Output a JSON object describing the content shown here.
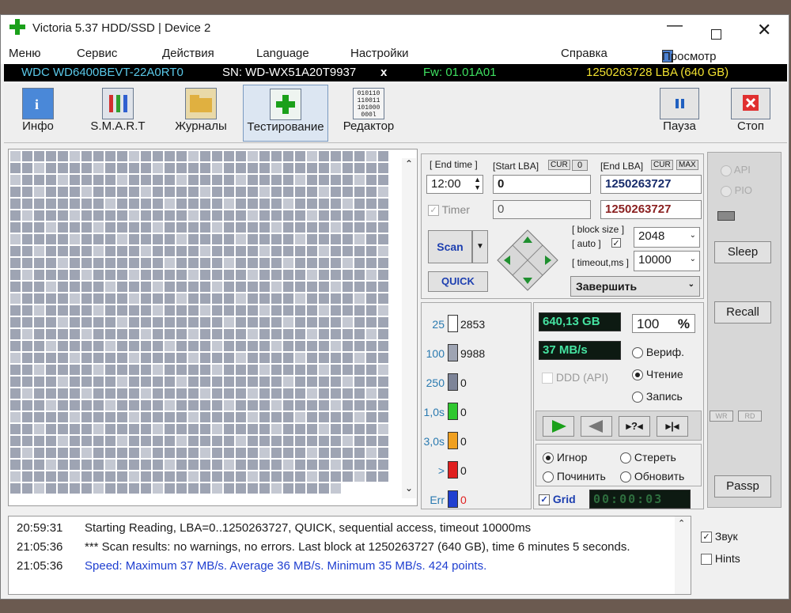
{
  "window": {
    "title": "Victoria 5.37 HDD/SSD | Device 2"
  },
  "menu": [
    "Меню",
    "Сервис",
    "Действия",
    "Language",
    "Настройки",
    "Справка"
  ],
  "menu_buffer": "Просмотр буфера",
  "device": {
    "model": "WDC WD6400BEVT-22A0RT0",
    "serial": "SN: WD-WX51A20T9937",
    "close": "x",
    "firmware": "Fw: 01.01A01",
    "capacity": "1250263728 LBA (640 GB)"
  },
  "toolbar": {
    "info": "Инфо",
    "smart": "S.M.A.R.T",
    "logs": "Журналы",
    "testing": "Тестирование",
    "editor": "Редактор",
    "pause": "Пауза",
    "stop": "Стоп",
    "editor_icon_text": "010110 110011 101000 000l"
  },
  "scan": {
    "end_time_label": "[ End time ]",
    "start_lba_label": "[Start LBA]",
    "cur": "CUR",
    "zero": "0",
    "end_lba_label": "[End LBA]",
    "max": "MAX",
    "time_value": "12:00",
    "start_lba": "0",
    "end_lba": "1250263727",
    "timer_label": "Timer",
    "timer_value": "0",
    "end_lba2": "1250263727",
    "block_size_label": "[ block size ]",
    "auto_label": "[ auto ]",
    "block_size": "2048",
    "timeout_label": "[ timeout,ms ]",
    "timeout": "10000",
    "scan_btn": "Scan",
    "quick_btn": "QUICK",
    "finish": "Завершить"
  },
  "legend": [
    {
      "ms": "25",
      "count": "2853",
      "color": "#ffffff"
    },
    {
      "ms": "100",
      "count": "9988",
      "color": "#9ea4b3"
    },
    {
      "ms": "250",
      "count": "0",
      "color": "#7d8498"
    },
    {
      "ms": "1,0s",
      "count": "0",
      "color": "#2fc82f"
    },
    {
      "ms": "3,0s",
      "count": "0",
      "color": "#f0a020"
    },
    {
      "ms": ">",
      "count": "0",
      "color": "#e02020"
    },
    {
      "ms": "Err",
      "count": "0",
      "color": "#2040d0"
    }
  ],
  "stats": {
    "size": "640,13 GB",
    "percent": "100",
    "percent_sign": "%",
    "speed": "37 MB/s",
    "ddd": "DDD (API)",
    "verify": "Вериф.",
    "read": "Чтение",
    "write": "Запись"
  },
  "actions": {
    "ignore": "Игнор",
    "erase": "Стереть",
    "repair": "Починить",
    "refresh": "Обновить",
    "grid": "Grid",
    "elapsed": "00:00:03"
  },
  "right": {
    "api": "API",
    "pio": "PIO",
    "sleep": "Sleep",
    "recall": "Recall",
    "wr": "WR",
    "rd": "RD",
    "passp": "Passp"
  },
  "log": [
    {
      "time": "20:59:31",
      "text": "Starting Reading, LBA=0..1250263727, QUICK, sequential access, timeout 10000ms",
      "color": "#1a1a1a"
    },
    {
      "time": "21:05:36",
      "text": "*** Scan results: no warnings, no errors. Last block at 1250263727 (640 GB), time 6 minutes 5 seconds.",
      "color": "#1a1a1a"
    },
    {
      "time": "21:05:36",
      "text": "Speed: Maximum 37 MB/s. Average 36 MB/s. Minimum 35 MB/s. 424 points.",
      "color": "#1f3fd0"
    }
  ],
  "options": {
    "sound": "Звук",
    "hints": "Hints"
  }
}
